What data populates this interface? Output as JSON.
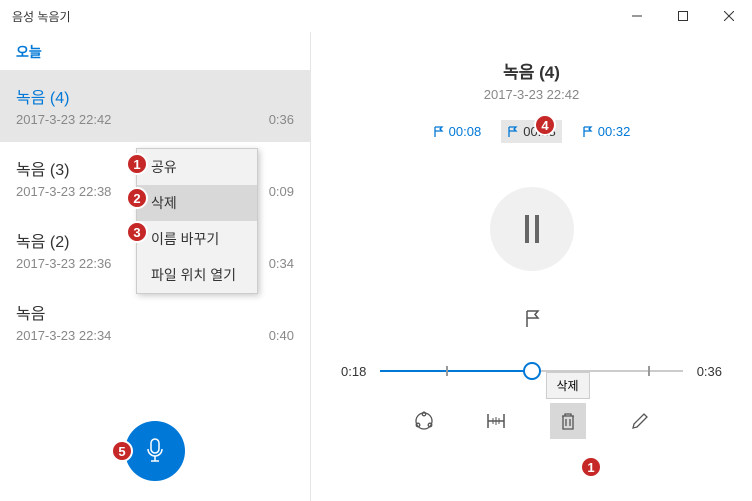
{
  "app_title": "음성 녹음기",
  "section_header": "오늘",
  "recordings": [
    {
      "title": "녹음 (4)",
      "datetime": "2017-3-23 22:42",
      "duration": "0:36",
      "selected": true
    },
    {
      "title": "녹음 (3)",
      "datetime": "2017-3-23 22:38",
      "duration": "0:09",
      "selected": false
    },
    {
      "title": "녹음 (2)",
      "datetime": "2017-3-23 22:36",
      "duration": "0:34",
      "selected": false
    },
    {
      "title": "녹음",
      "datetime": "2017-3-23 22:34",
      "duration": "0:40",
      "selected": false
    }
  ],
  "context_menu": {
    "share": "공유",
    "delete": "삭제",
    "rename": "이름 바꾸기",
    "open_location": "파일 위치 열기"
  },
  "detail": {
    "title": "녹음 (4)",
    "datetime": "2017-3-23 22:42",
    "markers": [
      {
        "time": "00:08",
        "active": false
      },
      {
        "time": "00:18",
        "active": true
      },
      {
        "time": "00:32",
        "active": false
      }
    ],
    "current_time": "0:18",
    "total_time": "0:36",
    "progress_pct": 50
  },
  "tooltip_delete": "삭제",
  "callouts": {
    "c1": "1",
    "c2": "2",
    "c3": "3",
    "c4": "4",
    "c5": "5",
    "c_del": "1"
  }
}
